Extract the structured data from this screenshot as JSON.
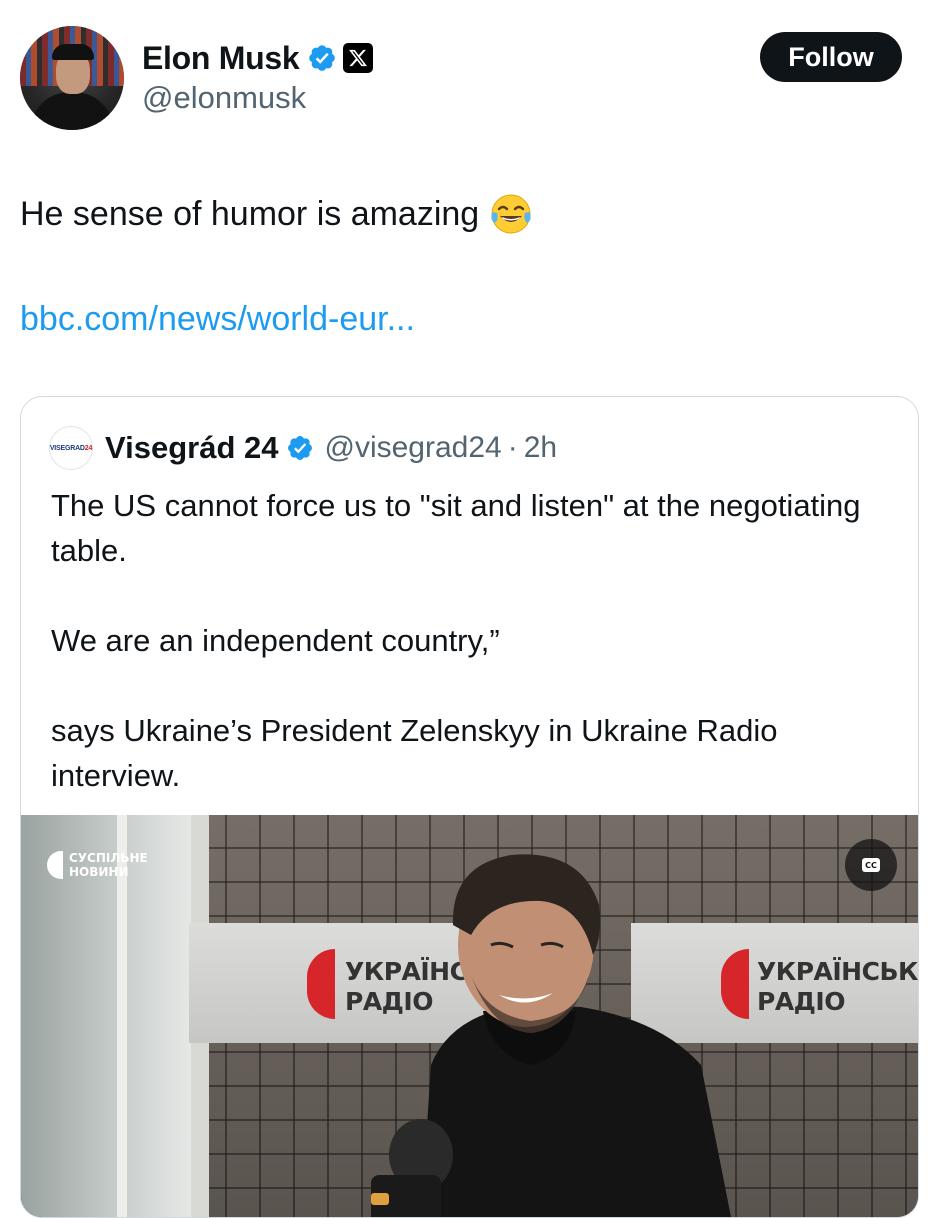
{
  "author": {
    "name": "Elon Musk",
    "handle": "@elonmusk",
    "avatar_icon": "profile-photo",
    "verified_icon": "verified-badge-icon",
    "affiliation_icon": "x-logo-icon"
  },
  "follow_button": {
    "label": "Follow"
  },
  "tweet": {
    "text": "He sense of humor is amazing",
    "emoji_icon": "face-with-tears-of-joy-icon",
    "link": "bbc.com/news/world-eur..."
  },
  "quoted_tweet": {
    "name": "Visegrád 24",
    "handle": "@visegrad24",
    "separator": "·",
    "time": "2h",
    "avatar_logo": {
      "main": "VISEGRAD",
      "accent": "24"
    },
    "paragraphs": [
      "The US cannot force us to \"sit and listen\" at the negotiating table.",
      "We are an independent country,”",
      "says Ukraine’s President Zelenskyy in Ukraine Radio interview."
    ],
    "media": {
      "broadcaster_line1": "СУСПІЛЬНЕ",
      "broadcaster_line2": "НОВИНИ",
      "captions_label": "CC",
      "sign_left_line1": "УКРАЇНС",
      "sign_left_line2": "РАДІО",
      "sign_right_line1": "УКРАЇНСЬКЕ",
      "sign_right_line2": "РАДІО"
    }
  },
  "colors": {
    "text": "#0f1419",
    "secondary": "#536471",
    "link": "#1d9bf0",
    "verified": "#1d9bf0",
    "border": "#cfd9de",
    "follow_bg": "#0f1419"
  }
}
